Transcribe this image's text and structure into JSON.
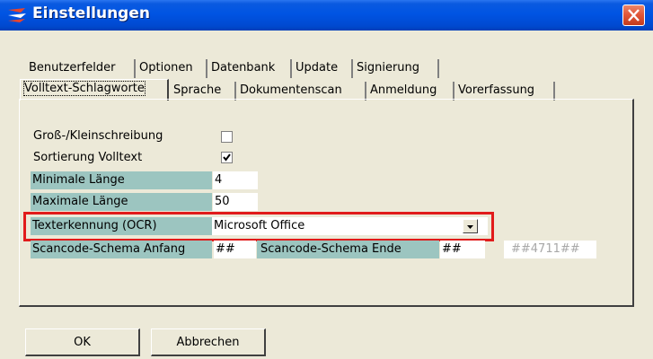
{
  "window": {
    "title": "Einstellungen",
    "icon": "app-logo-icon",
    "close_icon": "close-icon"
  },
  "tabs": {
    "row1": [
      "Benutzerfelder",
      "Optionen",
      "Datenbank",
      "Update",
      "Signierung"
    ],
    "row2": [
      "Volltext-Schlagworte",
      "Sprache",
      "Dokumentenscan",
      "Anmeldung",
      "Vorerfassung"
    ],
    "active": "Volltext-Schlagworte"
  },
  "form": {
    "case_label": "Groß-/Kleinschreibung",
    "case_checked": false,
    "sort_label": "Sortierung Volltext",
    "sort_checked": true,
    "min_length_label": "Minimale Länge",
    "min_length_value": "4",
    "max_length_label": "Maximale Länge",
    "max_length_value": "50",
    "ocr_label": "Texterkennung (OCR)",
    "ocr_value": "Microsoft Office",
    "scan_start_label": "Scancode-Schema Anfang",
    "scan_start_value": "##",
    "scan_end_label": "Scancode-Schema Ende",
    "scan_end_value": "##",
    "scan_example": "##4711##"
  },
  "buttons": {
    "ok": "OK",
    "cancel": "Abbrechen"
  },
  "colors": {
    "title_bar": "#0054e3",
    "label_highlight": "#9cc5c0",
    "annotation_box": "#e11b1b",
    "dialog_bg": "#ece9d8"
  }
}
